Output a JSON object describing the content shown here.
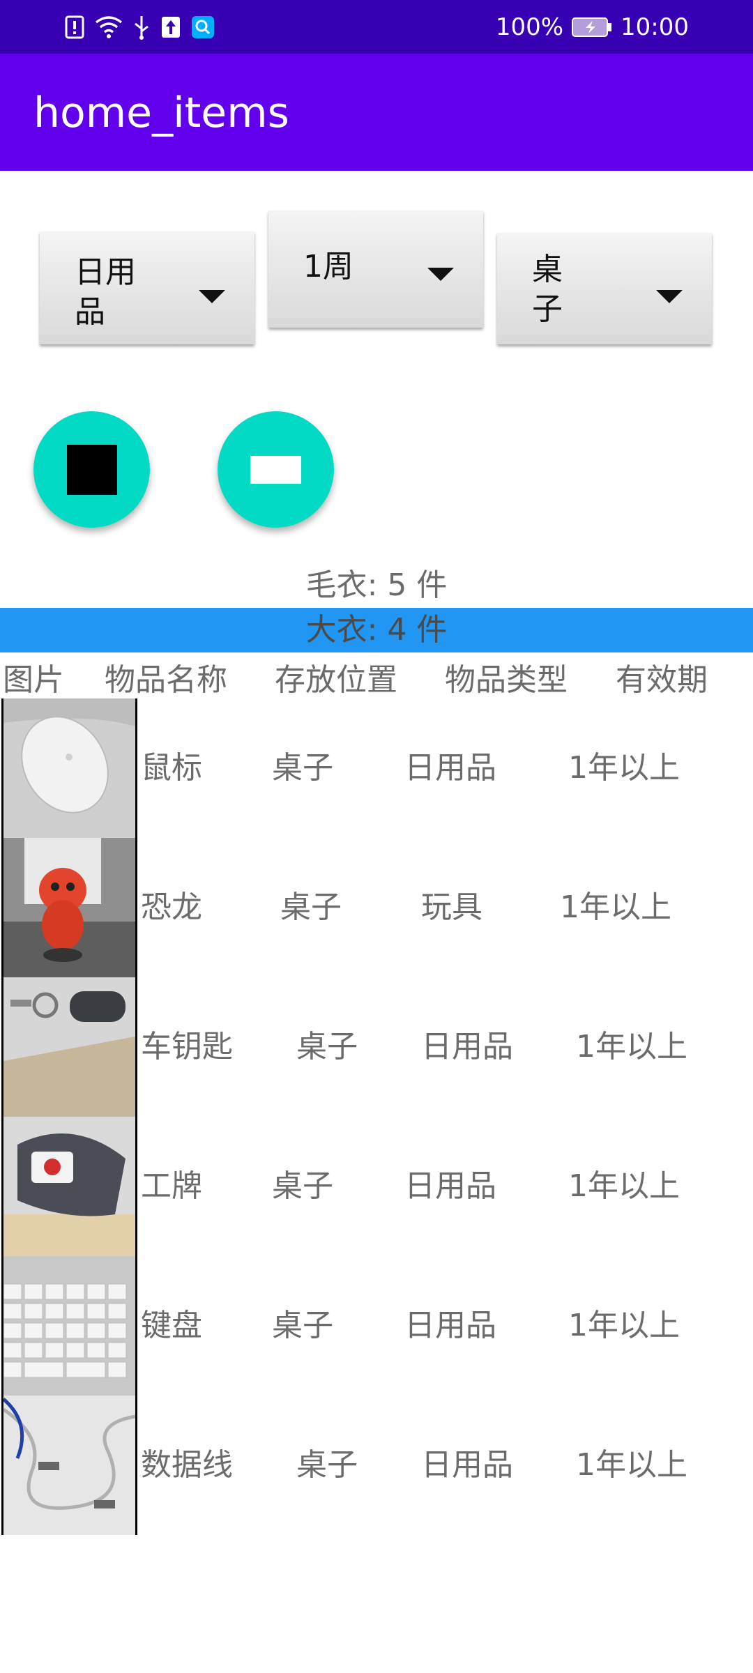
{
  "status_bar": {
    "battery": "100%",
    "time": "10:00",
    "icons": [
      "alert-icon",
      "wifi-icon",
      "usb-icon",
      "upload-icon",
      "search-app-icon",
      "battery-icon"
    ]
  },
  "appbar": {
    "title": "home_items"
  },
  "filters": {
    "type": "日用\n品",
    "period": "1周",
    "location": "桌\n子"
  },
  "summary": [
    {
      "label": "毛衣:  5 件"
    },
    {
      "label": "大衣:  4 件"
    }
  ],
  "table": {
    "headers": [
      "图片",
      "物品名称",
      "存放位置",
      "物品类型",
      "有效期"
    ],
    "rows": [
      {
        "name": "鼠标",
        "location": "桌子",
        "type": "日用品",
        "validity": "1年以上",
        "thumb": "mouse"
      },
      {
        "name": "恐龙",
        "location": "桌子",
        "type": "玩具",
        "validity": "1年以上",
        "thumb": "dinosaur"
      },
      {
        "name": "车钥匙",
        "location": "桌子",
        "type": "日用品",
        "validity": "1年以上",
        "thumb": "car-key"
      },
      {
        "name": "工牌",
        "location": "桌子",
        "type": "日用品",
        "validity": "1年以上",
        "thumb": "badge"
      },
      {
        "name": "键盘",
        "location": "桌子",
        "type": "日用品",
        "validity": "1年以上",
        "thumb": "keyboard"
      },
      {
        "name": "数据线",
        "location": "桌子",
        "type": "日用品",
        "validity": "1年以上",
        "thumb": "cable"
      }
    ]
  },
  "colors": {
    "status_bar": "#3700b3",
    "app_bar": "#6200ee",
    "fab": "#03dac5",
    "selected_row": "#2196f3"
  }
}
